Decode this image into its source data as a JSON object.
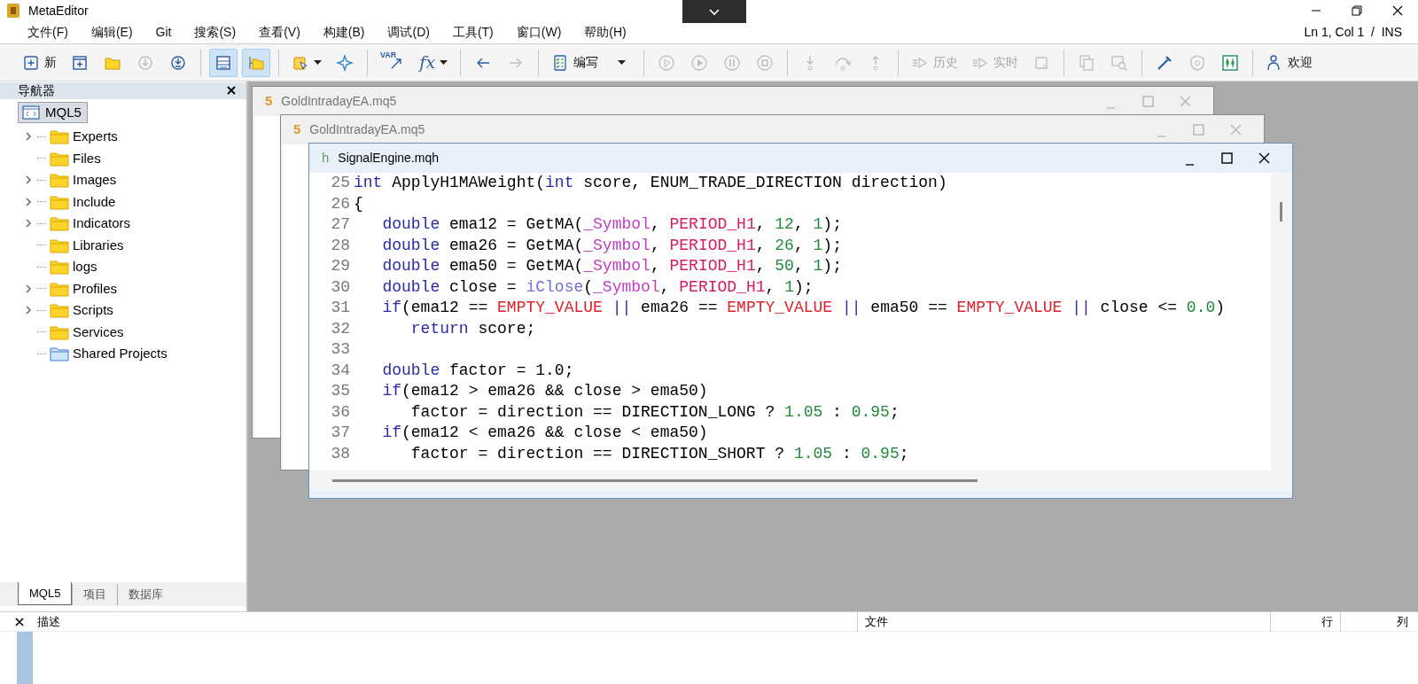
{
  "window": {
    "title": "MetaEditor"
  },
  "menu": [
    "文件(F)",
    "编辑(E)",
    "Git",
    "搜索(S)",
    "查看(V)",
    "构建(B)",
    "调试(D)",
    "工具(T)",
    "窗口(W)",
    "帮助(H)"
  ],
  "cursor_status": "Ln 1, Col 1  /  INS",
  "toolbar": [
    {
      "items": [
        {
          "label": "新",
          "disabled": false,
          "pressed": false,
          "dropdown": false
        },
        {
          "disabled": false,
          "pressed": false,
          "dropdown": false
        },
        {
          "disabled": false,
          "pressed": false,
          "dropdown": false
        },
        {
          "disabled": true,
          "pressed": false,
          "dropdown": false
        },
        {
          "disabled": false,
          "pressed": false,
          "dropdown": false
        }
      ]
    },
    {
      "items": [
        {
          "disabled": false,
          "pressed": true,
          "dropdown": false
        },
        {
          "disabled": false,
          "pressed": true,
          "dropdown": false
        }
      ]
    },
    {
      "items": [
        {
          "disabled": false,
          "pressed": false,
          "dropdown": true
        },
        {
          "disabled": false,
          "pressed": false,
          "dropdown": false
        }
      ]
    },
    {
      "items": [
        {
          "icon_text": "VAR",
          "disabled": false,
          "pressed": false,
          "dropdown": false
        },
        {
          "icon_text": "fx",
          "disabled": false,
          "pressed": false,
          "dropdown": true
        }
      ]
    },
    {
      "items": [
        {
          "disabled": false,
          "pressed": false,
          "dropdown": false
        },
        {
          "disabled": true,
          "pressed": false,
          "dropdown": false
        }
      ]
    },
    {
      "items": [
        {
          "label": "编写",
          "disabled": false,
          "pressed": false,
          "dropdown": false
        },
        {
          "disabled": false,
          "pressed": false,
          "dropdown": true
        }
      ]
    },
    {
      "items": [
        {
          "disabled": true,
          "pressed": false,
          "dropdown": false
        },
        {
          "disabled": true,
          "pressed": false,
          "dropdown": false
        },
        {
          "disabled": true,
          "pressed": false,
          "dropdown": false
        },
        {
          "disabled": true,
          "pressed": false,
          "dropdown": false
        }
      ]
    },
    {
      "items": [
        {
          "disabled": true,
          "pressed": false,
          "dropdown": false
        },
        {
          "disabled": true,
          "pressed": false,
          "dropdown": false
        },
        {
          "disabled": true,
          "pressed": false,
          "dropdown": false
        }
      ]
    },
    {
      "items": [
        {
          "label": "历史",
          "disabled": true,
          "pressed": false,
          "dropdown": false
        },
        {
          "label": "实时",
          "disabled": true,
          "pressed": false,
          "dropdown": false
        },
        {
          "disabled": true,
          "pressed": false,
          "dropdown": false
        }
      ]
    },
    {
      "items": [
        {
          "disabled": true,
          "pressed": false,
          "dropdown": false
        },
        {
          "disabled": true,
          "pressed": false,
          "dropdown": false
        }
      ]
    },
    {
      "items": [
        {
          "disabled": false,
          "pressed": false,
          "dropdown": false
        },
        {
          "disabled": true,
          "pressed": false,
          "dropdown": false
        },
        {
          "disabled": false,
          "pressed": false,
          "dropdown": false
        }
      ]
    },
    {
      "items": [
        {
          "label": "欢迎",
          "disabled": false,
          "pressed": false,
          "dropdown": false
        }
      ]
    }
  ],
  "navigator": {
    "title": "导航器",
    "tree": {
      "label": "MQL5",
      "selected": true,
      "children": [
        {
          "label": "Experts",
          "kind": "folder",
          "expandable": true
        },
        {
          "label": "Files",
          "kind": "folder",
          "expandable": false
        },
        {
          "label": "Images",
          "kind": "folder",
          "expandable": true
        },
        {
          "label": "Include",
          "kind": "folder",
          "expandable": true
        },
        {
          "label": "Indicators",
          "kind": "folder",
          "expandable": true
        },
        {
          "label": "Libraries",
          "kind": "folder",
          "expandable": false
        },
        {
          "label": "logs",
          "kind": "folder",
          "expandable": false
        },
        {
          "label": "Profiles",
          "kind": "folder",
          "expandable": true
        },
        {
          "label": "Scripts",
          "kind": "folder",
          "expandable": true
        },
        {
          "label": "Services",
          "kind": "folder",
          "expandable": false
        },
        {
          "label": "Shared Projects",
          "kind": "shared",
          "expandable": false
        }
      ]
    },
    "tabs": [
      {
        "label": "MQL5",
        "selected": true
      },
      {
        "label": "项目",
        "selected": false
      },
      {
        "label": "数据库",
        "selected": false
      }
    ]
  },
  "documents": [
    {
      "badge": "5",
      "kind": "mq5",
      "title": "GoldIntradayEA.mq5",
      "active": false
    },
    {
      "badge": "5",
      "kind": "mq5",
      "title": "GoldIntradayEA.mq5",
      "active": false
    },
    {
      "badge": "h",
      "kind": "mqh",
      "title": "SignalEngine.mqh",
      "active": true,
      "code": [
        {
          "number": "25",
          "tokens": [
            {
              "kind": "keyword",
              "text": "int"
            },
            {
              "kind": "plain",
              "text": " ApplyH1MAWeight("
            },
            {
              "kind": "keyword",
              "text": "int"
            },
            {
              "kind": "plain",
              "text": " score, ENUM_TRADE_DIRECTION direction)"
            }
          ]
        },
        {
          "number": "26",
          "tokens": [
            {
              "kind": "plain",
              "text": "{"
            }
          ]
        },
        {
          "number": "27",
          "tokens": [
            {
              "kind": "keyword",
              "text": "   double"
            },
            {
              "kind": "plain",
              "text": " ema12 = GetMA("
            },
            {
              "kind": "predefined",
              "text": "_Symbol"
            },
            {
              "kind": "plain",
              "text": ", "
            },
            {
              "kind": "constant",
              "text": "PERIOD_H1"
            },
            {
              "kind": "plain",
              "text": ", "
            },
            {
              "kind": "number",
              "text": "12"
            },
            {
              "kind": "plain",
              "text": ", "
            },
            {
              "kind": "number",
              "text": "1"
            },
            {
              "kind": "plain",
              "text": ");"
            }
          ]
        },
        {
          "number": "28",
          "tokens": [
            {
              "kind": "keyword",
              "text": "   double"
            },
            {
              "kind": "plain",
              "text": " ema26 = GetMA("
            },
            {
              "kind": "predefined",
              "text": "_Symbol"
            },
            {
              "kind": "plain",
              "text": ", "
            },
            {
              "kind": "constant",
              "text": "PERIOD_H1"
            },
            {
              "kind": "plain",
              "text": ", "
            },
            {
              "kind": "number",
              "text": "26"
            },
            {
              "kind": "plain",
              "text": ", "
            },
            {
              "kind": "number",
              "text": "1"
            },
            {
              "kind": "plain",
              "text": ");"
            }
          ]
        },
        {
          "number": "29",
          "tokens": [
            {
              "kind": "keyword",
              "text": "   double"
            },
            {
              "kind": "plain",
              "text": " ema50 = GetMA("
            },
            {
              "kind": "predefined",
              "text": "_Symbol"
            },
            {
              "kind": "plain",
              "text": ", "
            },
            {
              "kind": "constant",
              "text": "PERIOD_H1"
            },
            {
              "kind": "plain",
              "text": ", "
            },
            {
              "kind": "number",
              "text": "50"
            },
            {
              "kind": "plain",
              "text": ", "
            },
            {
              "kind": "number",
              "text": "1"
            },
            {
              "kind": "plain",
              "text": ");"
            }
          ]
        },
        {
          "number": "30",
          "tokens": [
            {
              "kind": "keyword",
              "text": "   double"
            },
            {
              "kind": "plain",
              "text": " close = "
            },
            {
              "kind": "function",
              "text": "iClose"
            },
            {
              "kind": "plain",
              "text": "("
            },
            {
              "kind": "predefined",
              "text": "_Symbol"
            },
            {
              "kind": "plain",
              "text": ", "
            },
            {
              "kind": "constant",
              "text": "PERIOD_H1"
            },
            {
              "kind": "plain",
              "text": ", "
            },
            {
              "kind": "number",
              "text": "1"
            },
            {
              "kind": "plain",
              "text": ");"
            }
          ]
        },
        {
          "number": "31",
          "tokens": [
            {
              "kind": "keyword",
              "text": "   if"
            },
            {
              "kind": "plain",
              "text": "(ema12 == "
            },
            {
              "kind": "macro",
              "text": "EMPTY_VALUE"
            },
            {
              "kind": "operator",
              "text": " ||"
            },
            {
              "kind": "plain",
              "text": " ema26 == "
            },
            {
              "kind": "macro",
              "text": "EMPTY_VALUE"
            },
            {
              "kind": "operator",
              "text": " ||"
            },
            {
              "kind": "plain",
              "text": " ema50 == "
            },
            {
              "kind": "macro",
              "text": "EMPTY_VALUE"
            },
            {
              "kind": "operator",
              "text": " ||"
            },
            {
              "kind": "plain",
              "text": " close <= "
            },
            {
              "kind": "number",
              "text": "0.0"
            },
            {
              "kind": "plain",
              "text": ")"
            }
          ]
        },
        {
          "number": "32",
          "tokens": [
            {
              "kind": "keyword",
              "text": "      return"
            },
            {
              "kind": "plain",
              "text": " score;"
            }
          ]
        },
        {
          "number": "33"
        },
        {
          "number": "34",
          "tokens": [
            {
              "kind": "keyword",
              "text": "   double"
            },
            {
              "kind": "plain",
              "text": " factor = 1.0;"
            }
          ]
        },
        {
          "number": "35",
          "tokens": [
            {
              "kind": "keyword",
              "text": "   if"
            },
            {
              "kind": "plain",
              "text": "(ema12 > ema26 && close > ema50)"
            }
          ]
        },
        {
          "number": "36",
          "tokens": [
            {
              "kind": "plain",
              "text": "      factor = direction == DIRECTION_LONG ? "
            },
            {
              "kind": "number",
              "text": "1.05"
            },
            {
              "kind": "plain",
              "text": " : "
            },
            {
              "kind": "number",
              "text": "0.95"
            },
            {
              "kind": "plain",
              "text": ";"
            }
          ]
        },
        {
          "number": "37",
          "tokens": [
            {
              "kind": "keyword",
              "text": "   if"
            },
            {
              "kind": "plain",
              "text": "(ema12 < ema26 && close < ema50)"
            }
          ]
        },
        {
          "number": "38",
          "tokens": [
            {
              "kind": "plain",
              "text": "      factor = direction == DIRECTION_SHORT ? "
            },
            {
              "kind": "number",
              "text": "1.05"
            },
            {
              "kind": "plain",
              "text": " : "
            },
            {
              "kind": "number",
              "text": "0.95"
            },
            {
              "kind": "plain",
              "text": ";"
            }
          ]
        }
      ]
    }
  ],
  "output_panel": {
    "columns": [
      "描述",
      "文件",
      "行",
      "列"
    ]
  }
}
